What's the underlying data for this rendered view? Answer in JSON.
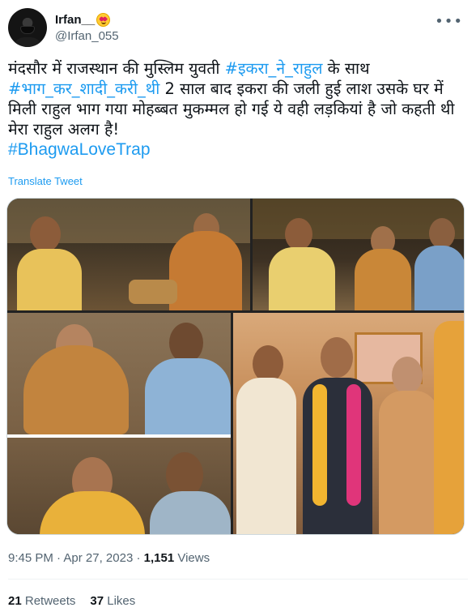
{
  "author": {
    "display_name": "Irfan__",
    "emoji_icon": "heart-eyes-emoji",
    "handle": "@Irfan_055",
    "more_icon": "more-horizontal-icon"
  },
  "tweet": {
    "text_seg1": "मंदसौर में राजस्थान की मुस्लिम युवती ",
    "hashtag1": "#इकरा_ने_राहुल",
    "text_seg2": " के साथ ",
    "hashtag2": "#भाग_कर_शादी_करी_थी",
    "text_seg3": " 2 साल बाद इकरा की जली हुई लाश उसके घर में मिली राहुल भाग गया मोहब्बत मुकम्मल हो गई ये वही लड़कियां है जो कहती थी मेरा राहुल अलग है!",
    "hashtag3": "#BhagwaLoveTrap",
    "translate_label": "Translate Tweet"
  },
  "media": {
    "photos": [
      "wedding-ritual-photo-1",
      "wedding-ritual-photo-2",
      "wedding-ritual-photo-3",
      "wedding-garland-photo-4"
    ]
  },
  "meta": {
    "time": "9:45 PM",
    "separator": "·",
    "date": "Apr 27, 2023",
    "views_count": "1,151",
    "views_label": "Views"
  },
  "stats": {
    "retweets_count": "21",
    "retweets_label": "Retweets",
    "likes_count": "37",
    "likes_label": "Likes"
  },
  "colors": {
    "accent": "#1d9bf0",
    "text": "#0f1419",
    "secondary": "#536471",
    "divider": "#eff3f4"
  }
}
